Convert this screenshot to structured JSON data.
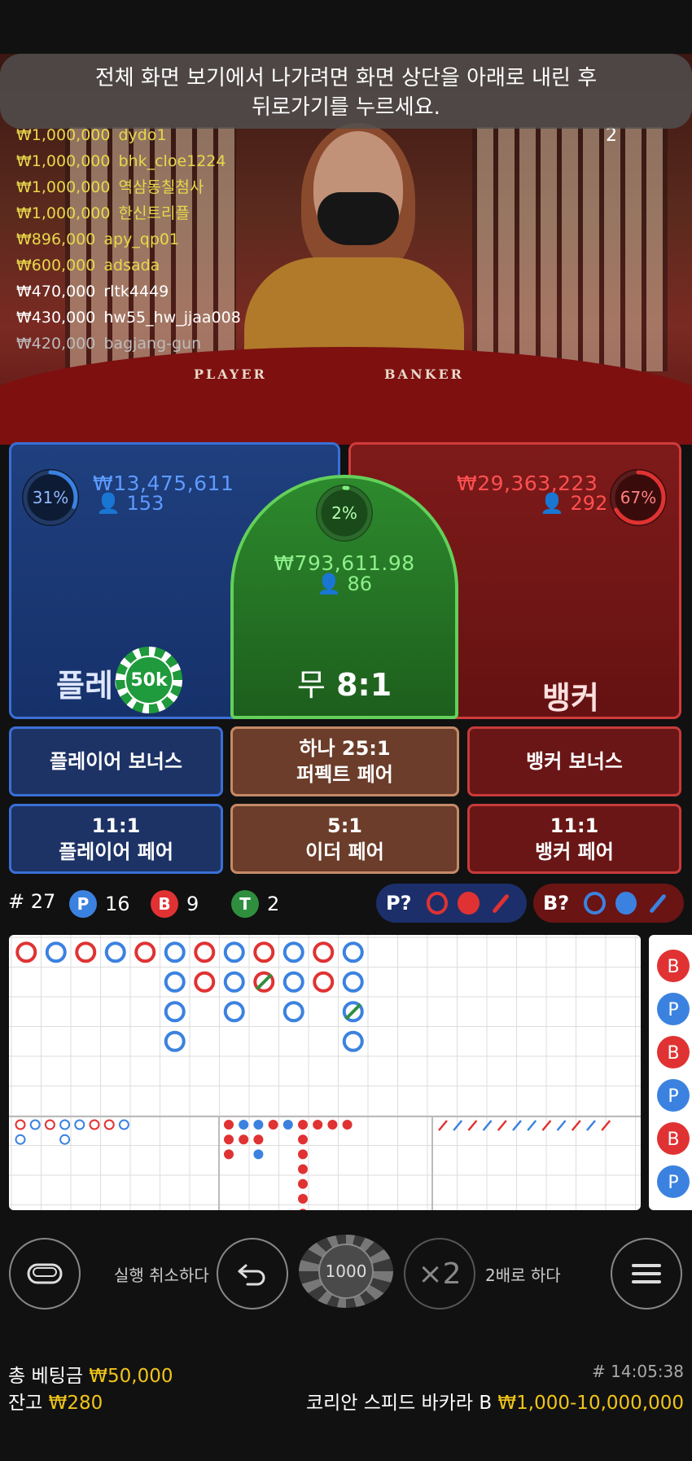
{
  "toast": {
    "line1": "전체 화면 보기에서 나가려면 화면 상단을 아래로 내린 후",
    "line2": "뒤로가기를 누르세요."
  },
  "video": {
    "round_counter": "2",
    "felt_player": "PLAYER",
    "felt_banker": "BANKER"
  },
  "leaderboard": [
    {
      "amount": "₩1,000,000",
      "name": "dydo1",
      "color": "#e8d84a"
    },
    {
      "amount": "₩1,000,000",
      "name": "bhk_cloe1224",
      "color": "#e8d84a"
    },
    {
      "amount": "₩1,000,000",
      "name": "역삼동칠첨사",
      "color": "#e8d84a"
    },
    {
      "amount": "₩1,000,000",
      "name": "한신트리플",
      "color": "#e8d84a"
    },
    {
      "amount": "₩896,000",
      "name": "apy_qp01",
      "color": "#e8d84a"
    },
    {
      "amount": "₩600,000",
      "name": "adsada",
      "color": "#e8d84a"
    },
    {
      "amount": "₩470,000",
      "name": "rltk4449",
      "color": "#ffffff"
    },
    {
      "amount": "₩430,000",
      "name": "hw55_hw_jjaa008",
      "color": "#ffffff"
    },
    {
      "amount": "₩420,000",
      "name": "bagjang-gun",
      "color": "#bbbbbb"
    }
  ],
  "player": {
    "percent": "31%",
    "percent_value": 31,
    "amount": "₩13,475,611",
    "count": "153",
    "label": "플레이어"
  },
  "banker": {
    "percent": "67%",
    "percent_value": 67,
    "amount": "₩29,363,223",
    "count": "292",
    "label": "뱅커"
  },
  "tie": {
    "percent": "2%",
    "percent_value": 2,
    "amount": "₩793,611.98",
    "count": "86",
    "label_prefix": "무",
    "odds": "8:1"
  },
  "placed_chip": "50k",
  "side_bets": {
    "player_bonus": "플레이어 보너스",
    "perfect_pair_top": "하나 25:1",
    "perfect_pair_bottom": "퍼펙트 페어",
    "banker_bonus": "뱅커 보너스",
    "player_pair_odds": "11:1",
    "player_pair": "플레이어 페어",
    "either_pair_odds": "5:1",
    "either_pair": "이더 페어",
    "banker_pair_odds": "11:1",
    "banker_pair": "뱅커 페어"
  },
  "stats": {
    "rounds": "# 27",
    "player_letter": "P",
    "player_count": "16",
    "banker_letter": "B",
    "banker_count": "9",
    "tie_letter": "T",
    "tie_count": "2",
    "player_predict": "P?",
    "banker_predict": "B?"
  },
  "colors": {
    "player": "#3b82e0",
    "banker": "#e03232",
    "tie": "#2f8f3f",
    "yellow": "#f0c419"
  },
  "big_road": [
    [
      "B"
    ],
    [
      "P"
    ],
    [
      "B"
    ],
    [
      "P"
    ],
    [
      "B"
    ],
    [
      "P",
      "P",
      "P",
      "P"
    ],
    [
      "B",
      "B"
    ],
    [
      "P",
      "P",
      "P"
    ],
    [
      "B",
      "T"
    ],
    [
      "P",
      "P",
      "P"
    ],
    [
      "B",
      "B"
    ],
    [
      "P",
      "P",
      "T",
      "P"
    ]
  ],
  "bead_small": [
    [
      "B",
      "P"
    ],
    [
      "P"
    ],
    [
      "B"
    ],
    [
      "P",
      "P"
    ],
    [
      "P"
    ],
    [
      "B"
    ],
    [
      "B"
    ],
    [
      "P"
    ]
  ],
  "eye_road": [
    [
      "R",
      "R",
      "R"
    ],
    [
      "B",
      "R"
    ],
    [
      "B",
      "R",
      "B"
    ],
    [
      "R"
    ],
    [
      "B"
    ],
    [
      "R",
      "R",
      "R",
      "R",
      "R",
      "R",
      "R"
    ],
    [
      "R"
    ],
    [
      "R"
    ],
    [
      "R"
    ]
  ],
  "cockroach": [
    "R",
    "B",
    "R",
    "B",
    "R",
    "B",
    "B",
    "R",
    "B",
    "R",
    "B",
    "R"
  ],
  "side_road": [
    "B",
    "P",
    "B",
    "P",
    "B",
    "P"
  ],
  "controls": {
    "undo_label": "실행 취소하다",
    "chip_value": "1000",
    "double_icon": "×2",
    "double_label": "2배로 하다"
  },
  "footer": {
    "total_bet_label": "총 베팅금",
    "total_bet_value": "₩50,000",
    "balance_label": "잔고",
    "balance_value": "₩280",
    "time": "# 14:05:38",
    "table_name": "코리안 스피드 바카라 B",
    "limits": "₩1,000-10,000,000"
  }
}
